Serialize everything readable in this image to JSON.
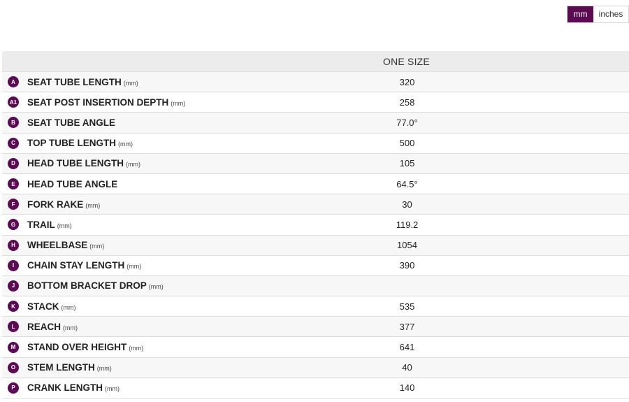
{
  "accent_color": "#5c0b52",
  "unit_toggle": {
    "mm_label": "mm",
    "inches_label": "inches",
    "selected": "mm"
  },
  "table": {
    "column_header": "ONE SIZE",
    "rows": [
      {
        "badge": "A",
        "label": "SEAT TUBE LENGTH",
        "unit": "(mm)",
        "value": "320"
      },
      {
        "badge": "A1",
        "label": "SEAT POST INSERTION DEPTH",
        "unit": "(mm)",
        "value": "258"
      },
      {
        "badge": "B",
        "label": "SEAT TUBE ANGLE",
        "unit": "",
        "value": "77.0°"
      },
      {
        "badge": "C",
        "label": "TOP TUBE LENGTH",
        "unit": "(mm)",
        "value": "500"
      },
      {
        "badge": "D",
        "label": "HEAD TUBE LENGTH",
        "unit": "(mm)",
        "value": "105"
      },
      {
        "badge": "E",
        "label": "HEAD TUBE ANGLE",
        "unit": "",
        "value": "64.5°"
      },
      {
        "badge": "F",
        "label": "FORK RAKE",
        "unit": "(mm)",
        "value": "30"
      },
      {
        "badge": "G",
        "label": "TRAIL",
        "unit": "(mm)",
        "value": "119.2"
      },
      {
        "badge": "H",
        "label": "WHEELBASE",
        "unit": "(mm)",
        "value": "1054"
      },
      {
        "badge": "I",
        "label": "CHAIN STAY LENGTH",
        "unit": "(mm)",
        "value": "390"
      },
      {
        "badge": "J",
        "label": "BOTTOM BRACKET DROP",
        "unit": "(mm)",
        "value": ""
      },
      {
        "badge": "K",
        "label": "STACK",
        "unit": "(mm)",
        "value": "535"
      },
      {
        "badge": "L",
        "label": "REACH",
        "unit": "(mm)",
        "value": "377"
      },
      {
        "badge": "M",
        "label": "STAND OVER HEIGHT",
        "unit": "(mm)",
        "value": "641"
      },
      {
        "badge": "O",
        "label": "STEM LENGTH",
        "unit": "(mm)",
        "value": "40"
      },
      {
        "badge": "P",
        "label": "CRANK LENGTH",
        "unit": "(mm)",
        "value": "140"
      }
    ]
  }
}
